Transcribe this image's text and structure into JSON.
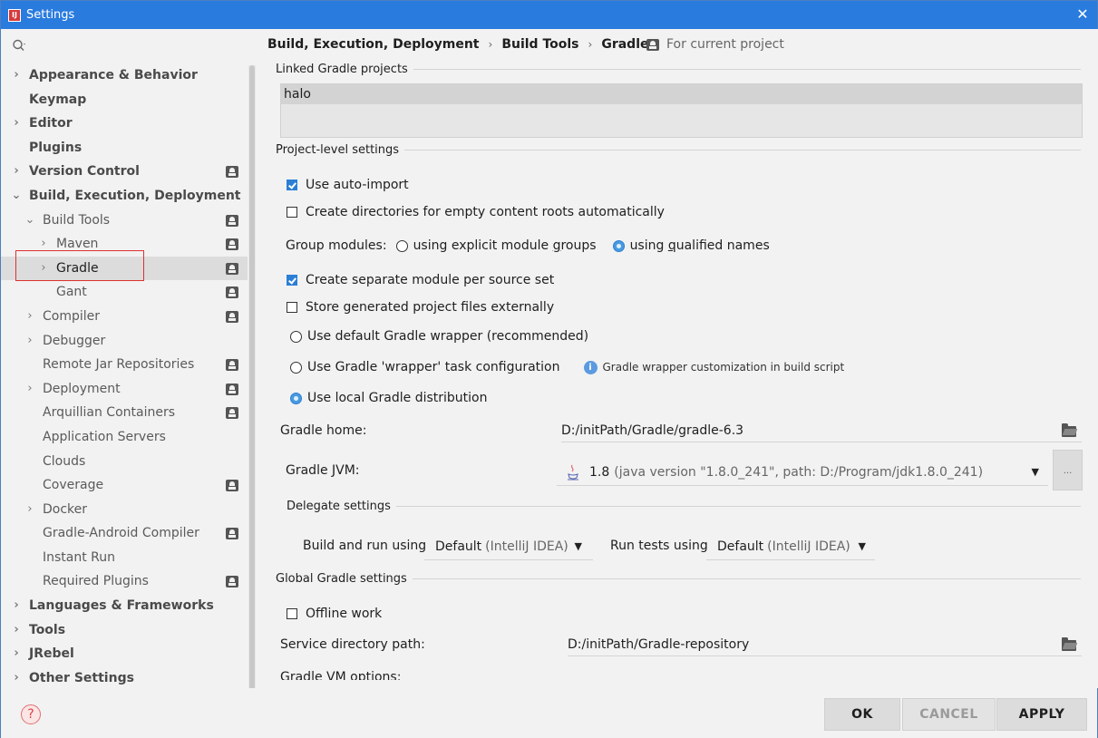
{
  "window": {
    "title": "Settings"
  },
  "sidebar": {
    "items": [
      {
        "label": "Appearance & Behavior",
        "arrow": "›",
        "bold": true
      },
      {
        "label": "Keymap",
        "arrow": "",
        "bold": true
      },
      {
        "label": "Editor",
        "arrow": "›",
        "bold": true
      },
      {
        "label": "Plugins",
        "arrow": "",
        "bold": true
      },
      {
        "label": "Version Control",
        "arrow": "›",
        "bold": true
      },
      {
        "label": "Build, Execution, Deployment",
        "arrow": "⌄",
        "bold": true
      },
      {
        "label": "Build Tools",
        "arrow": "⌄"
      },
      {
        "label": "Maven",
        "arrow": "›"
      },
      {
        "label": "Gradle",
        "arrow": "›"
      },
      {
        "label": "Gant",
        "arrow": ""
      },
      {
        "label": "Compiler",
        "arrow": "›"
      },
      {
        "label": "Debugger",
        "arrow": "›"
      },
      {
        "label": "Remote Jar Repositories",
        "arrow": ""
      },
      {
        "label": "Deployment",
        "arrow": "›"
      },
      {
        "label": "Arquillian Containers",
        "arrow": ""
      },
      {
        "label": "Application Servers",
        "arrow": ""
      },
      {
        "label": "Clouds",
        "arrow": ""
      },
      {
        "label": "Coverage",
        "arrow": ""
      },
      {
        "label": "Docker",
        "arrow": "›"
      },
      {
        "label": "Gradle-Android Compiler",
        "arrow": ""
      },
      {
        "label": "Instant Run",
        "arrow": ""
      },
      {
        "label": "Required Plugins",
        "arrow": ""
      },
      {
        "label": "Languages & Frameworks",
        "arrow": "›",
        "bold": true
      },
      {
        "label": "Tools",
        "arrow": "›",
        "bold": true
      },
      {
        "label": "JRebel",
        "arrow": "›",
        "bold": true
      },
      {
        "label": "Other Settings",
        "arrow": "›",
        "bold": true
      }
    ]
  },
  "breadcrumb": {
    "part1": "Build, Execution, Deployment",
    "part2": "Build Tools",
    "part3": "Gradle",
    "sep": "›",
    "for_current_project": "For current project"
  },
  "linked": {
    "title": "Linked Gradle projects",
    "items": [
      "halo"
    ]
  },
  "project_level": {
    "title": "Project-level settings",
    "use_auto_import": "Use auto-import",
    "create_dirs": "Create directories for empty content roots automatically",
    "group_modules_label": "Group modules:",
    "group_explicit_pre": "using explicit module ",
    "group_explicit_u": "g",
    "group_explicit_post": "roups",
    "group_qualified_pre": "using ",
    "group_qualified_u": "q",
    "group_qualified_post": "ualified names",
    "separate_module": "Create separate module per source set",
    "store_external": "Store generated project files externally",
    "default_wrapper": "Use default Gradle wrapper (recommended)",
    "wrapper_task": "Use Gradle 'wrapper' task configuration",
    "wrapper_hint": "Gradle wrapper customization in build script",
    "local_dist": "Use local Gradle distribution",
    "gradle_home_label": "Gradle home:",
    "gradle_home_value": "D:/initPath/Gradle/gradle-6.3",
    "gradle_jvm_label": "Gradle JVM:",
    "gradle_jvm_version": "1.8",
    "gradle_jvm_detail": "(java version \"1.8.0_241\", path: D:/Program/jdk1.8.0_241)",
    "more": "..."
  },
  "delegate": {
    "title": "Delegate settings",
    "build_run_label": "Build and run using",
    "build_run_value": "Default",
    "build_run_dim": "(IntelliJ IDEA)",
    "run_tests_label": "Run tests using",
    "run_tests_value": "Default",
    "run_tests_dim": "(IntelliJ IDEA)",
    "arrow": "▼"
  },
  "global": {
    "title": "Global Gradle settings",
    "offline": "Offline work",
    "service_dir_label": "Service directory path:",
    "service_dir_value": "D:/initPath/Gradle-repository",
    "vm_options_label": "Gradle VM options:"
  },
  "buttons": {
    "ok": "OK",
    "cancel": "CANCEL",
    "apply": "APPLY",
    "help": "?"
  },
  "icons": {
    "close": "✕",
    "search": "search-icon"
  },
  "colors": {
    "titlebar": "#2a7bde",
    "accent": "#2b7fd6",
    "selection": "#dcdcdc",
    "highlight_box": "#e03030"
  }
}
